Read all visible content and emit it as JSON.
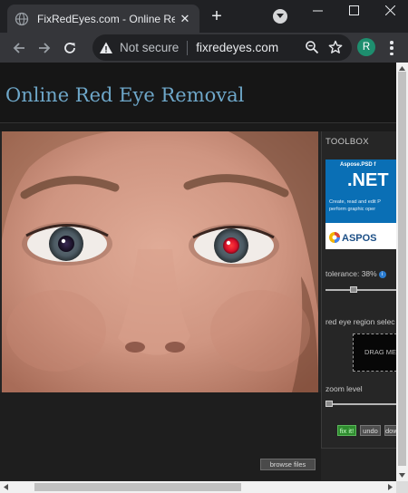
{
  "browser": {
    "tab_title": "FixRedEyes.com - Online Red Eye Removal",
    "security_label": "Not secure",
    "url": "fixredeyes.com",
    "profile_initial": "R"
  },
  "page": {
    "title": "Online Red Eye Removal",
    "toolbox": {
      "heading": "TOOLBOX",
      "ad": {
        "brand": "Aspose.PSD f",
        "headline": ".NET",
        "line1": "Create, read and edit P",
        "line2": "perform graphic oper",
        "logo_text": "ASPOS"
      },
      "tolerance_label": "tolerance: 38%",
      "tolerance_value": 38,
      "region_label": "red eye region selec",
      "drag_label": "DRAG ME",
      "zoom_label": "zoom level",
      "zoom_value": 0,
      "fix_button": "fix it!",
      "undo_button": "undo",
      "download_button": "dow"
    },
    "browse_button": "browse files"
  },
  "colors": {
    "title": "#6ea7c9",
    "avatar": "#1e8e6e",
    "fix_button": "#2f8c2f"
  }
}
